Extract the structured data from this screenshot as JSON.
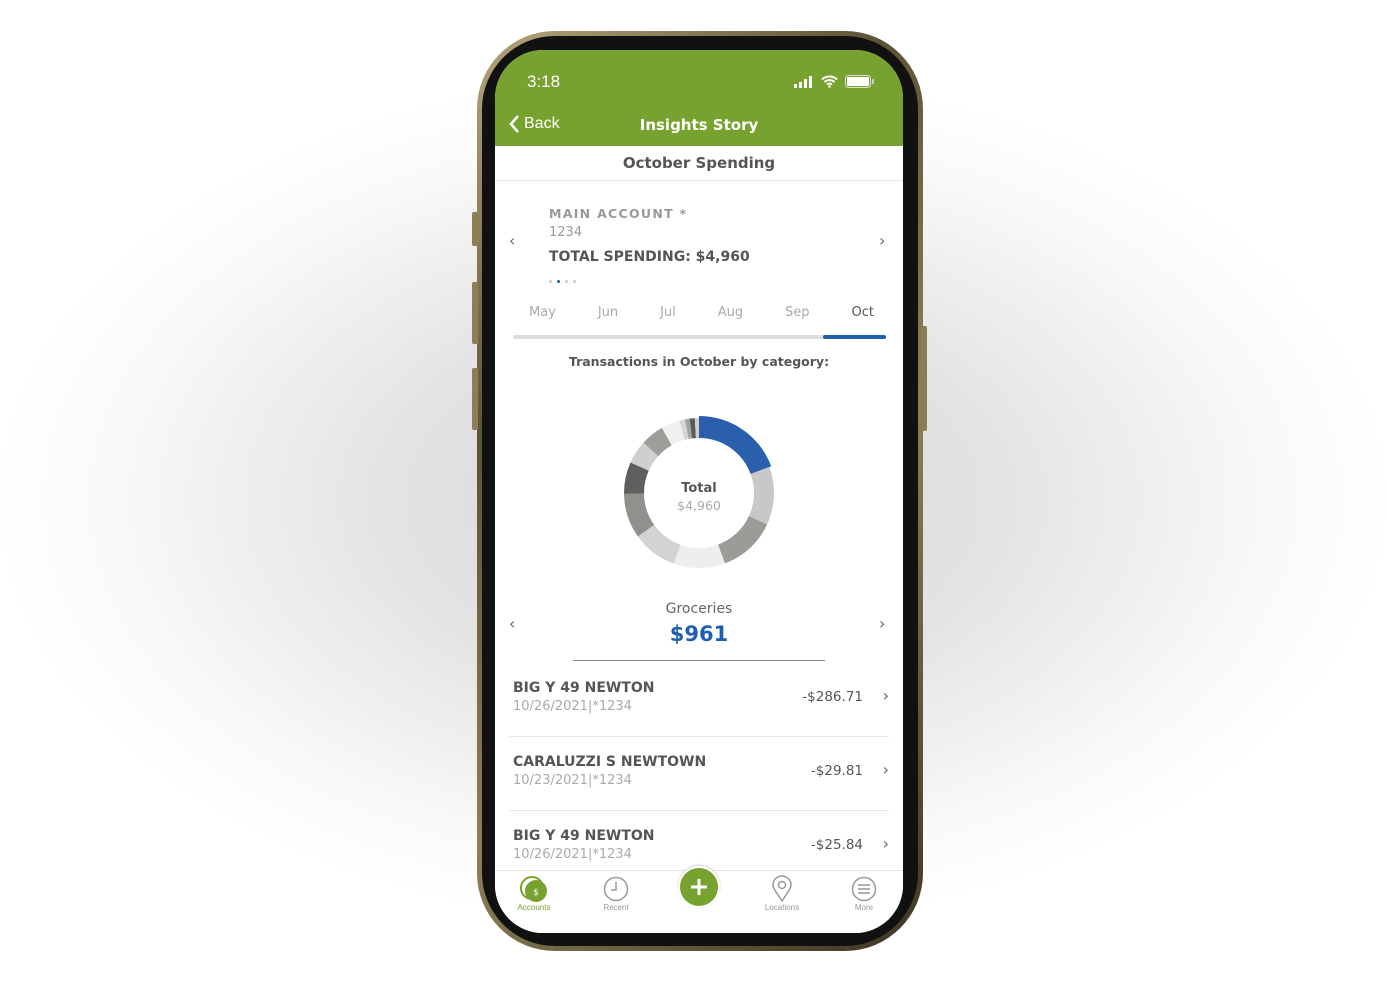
{
  "status_bar": {
    "time": "3:18",
    "icons": [
      "signal-icon",
      "wifi-icon",
      "battery-icon"
    ]
  },
  "nav": {
    "back_label": "Back",
    "title": "Insights Story"
  },
  "subtitle": "October Spending",
  "account": {
    "name": "MAIN ACCOUNT *",
    "number": "1234",
    "total_spending": "TOTAL SPENDING: $4,960",
    "page_dots": 4,
    "active_dot": 1
  },
  "months": [
    {
      "label": "May"
    },
    {
      "label": "Jun"
    },
    {
      "label": "Jul"
    },
    {
      "label": "Aug"
    },
    {
      "label": "Sep"
    },
    {
      "label": "Oct",
      "active": true
    }
  ],
  "transactions_heading": "Transactions in October by category:",
  "chart_data": {
    "type": "pie",
    "style": "donut",
    "center_label": "Total",
    "center_value": "$4,960",
    "total": 4960,
    "highlighted": "Groceries",
    "slices": [
      {
        "name": "Groceries",
        "value": 961,
        "color": "#2a5fab"
      },
      {
        "value": 620,
        "color": "#c8c8c8"
      },
      {
        "value": 620,
        "color": "#9a9c98"
      },
      {
        "value": 550,
        "color": "#eeeeee"
      },
      {
        "value": 480,
        "color": "#d3d3d3"
      },
      {
        "value": 480,
        "color": "#8f918d"
      },
      {
        "value": 340,
        "color": "#5e605d"
      },
      {
        "value": 250,
        "color": "#cfcfcf"
      },
      {
        "value": 250,
        "color": "#9c9e9a"
      },
      {
        "value": 200,
        "color": "#f0f0f0"
      },
      {
        "value": 60,
        "color": "#d6d6d6"
      },
      {
        "value": 50,
        "color": "#a2a4a0"
      },
      {
        "value": 55,
        "color": "#5a5c59"
      },
      {
        "value": 44,
        "color": "#cfcfcf"
      }
    ]
  },
  "category": {
    "name": "Groceries",
    "amount": "$961",
    "color": "#1f5fad"
  },
  "transactions": [
    {
      "merchant": "BIG Y 49 NEWTON",
      "date": "10/26/2021",
      "account": "*1234",
      "amount": "-$286.71"
    },
    {
      "merchant": "CARALUZZI S NEWTOWN",
      "date": "10/23/2021",
      "account": "*1234",
      "amount": "-$29.81"
    },
    {
      "merchant": "BIG Y 49 NEWTON",
      "date": "10/26/2021",
      "account": "*1234",
      "amount": "-$25.84"
    }
  ],
  "tabbar": {
    "items": [
      {
        "label": "Accounts",
        "active": true
      },
      {
        "label": "Recent"
      },
      {
        "label": "Locations"
      },
      {
        "label": "More"
      }
    ],
    "add_icon": "plus-icon"
  },
  "colors": {
    "brand_green": "#78a22f",
    "accent_blue": "#1f5fad"
  }
}
